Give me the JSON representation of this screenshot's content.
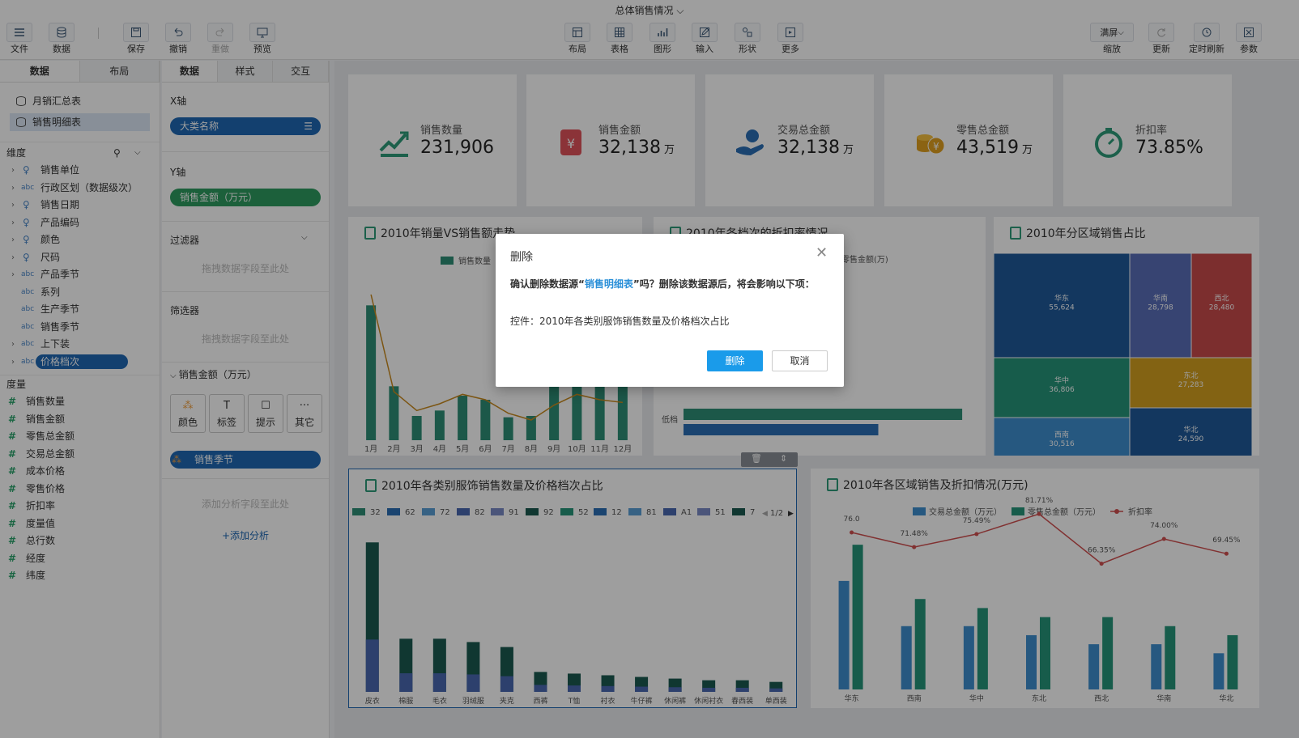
{
  "title": "总体销售情况",
  "toolbar": {
    "left": [
      {
        "label": "文件",
        "icon": "menu-icon"
      },
      {
        "label": "数据",
        "icon": "database-icon"
      },
      {
        "label": "保存",
        "icon": "save-icon"
      },
      {
        "label": "撤销",
        "icon": "undo-icon"
      },
      {
        "label": "重做",
        "icon": "redo-icon"
      },
      {
        "label": "预览",
        "icon": "preview-icon"
      }
    ],
    "center": [
      {
        "label": "布局",
        "icon": "layout-icon"
      },
      {
        "label": "表格",
        "icon": "table-icon"
      },
      {
        "label": "图形",
        "icon": "chart-icon"
      },
      {
        "label": "输入",
        "icon": "edit-icon"
      },
      {
        "label": "形状",
        "icon": "shape-icon"
      },
      {
        "label": "更多",
        "icon": "more-icon"
      }
    ],
    "right": [
      {
        "label": "缩放",
        "value": "满屏"
      },
      {
        "label": "更新",
        "icon": "refresh-icon"
      },
      {
        "label": "定时刷新",
        "icon": "clock-icon"
      },
      {
        "label": "参数",
        "icon": "param-icon"
      }
    ]
  },
  "left_panel": {
    "tabs": [
      "数据",
      "布局"
    ],
    "datasources": [
      "月销汇总表",
      "销售明细表"
    ],
    "dim_title": "维度",
    "dimensions": [
      {
        "name": "销售单位",
        "type": "geo",
        "arrow": true
      },
      {
        "name": "行政区划（数据级次）",
        "type": "abc",
        "arrow": true
      },
      {
        "name": "销售日期",
        "type": "geo",
        "arrow": true
      },
      {
        "name": "产品编码",
        "type": "geo",
        "arrow": true
      },
      {
        "name": "颜色",
        "type": "geo",
        "arrow": true
      },
      {
        "name": "尺码",
        "type": "geo",
        "arrow": true
      },
      {
        "name": "产品季节",
        "type": "abc",
        "arrow": true
      },
      {
        "name": "系列",
        "type": "abc",
        "arrow": false
      },
      {
        "name": "生产季节",
        "type": "abc",
        "arrow": false
      },
      {
        "name": "销售季节",
        "type": "abc",
        "arrow": false
      },
      {
        "name": "上下装",
        "type": "abc",
        "arrow": true
      },
      {
        "name": "价格档次",
        "type": "abc",
        "arrow": true
      }
    ],
    "meas_title": "度量",
    "measures": [
      "销售数量",
      "销售金额",
      "零售总金额",
      "交易总金额",
      "成本价格",
      "零售价格",
      "折扣率",
      "度量值",
      "总行数",
      "经度",
      "纬度"
    ]
  },
  "mid_panel": {
    "tabs": [
      "数据",
      "样式",
      "交互"
    ],
    "x_label": "X轴",
    "x_pill": "大类名称",
    "y_label": "Y轴",
    "y_pill": "销售金额（万元）",
    "filter_label": "过滤器",
    "drop_hint": "拖拽数据字段至此处",
    "screen_label": "筛选器",
    "mark_label": "销售金额（万元）",
    "marks": [
      "颜色",
      "标签",
      "提示",
      "其它"
    ],
    "color_pill": "销售季节",
    "analysis_hint": "添加分析字段至此处",
    "add_analysis": "+添加分析"
  },
  "kpis": [
    {
      "label": "销售数量",
      "value": "231,906",
      "unit": "",
      "color": "#2e9c7a"
    },
    {
      "label": "销售金额",
      "value": "32,138",
      "unit": "万",
      "color": "#e0535b"
    },
    {
      "label": "交易总金额",
      "value": "32,138",
      "unit": "万",
      "color": "#2a6fb5"
    },
    {
      "label": "零售总金额",
      "value": "43,519",
      "unit": "万",
      "color": "#e0a020"
    },
    {
      "label": "折扣率",
      "value": "73.85%",
      "unit": "",
      "color": "#2e9c7a"
    }
  ],
  "charts": {
    "c1_title": "2010年销量VS销售额走势",
    "c2_title": "2010年各档次的折扣率情况",
    "c3_title": "2010年分区域销售占比",
    "c4_title": "2010年各类别服饰销售数量及价格档次占比",
    "c5_title": "2010年各区域销售及折扣情况(万元)"
  },
  "chart_data": [
    {
      "type": "bar",
      "title": "2010年销量VS销售额走势",
      "categories": [
        "1月",
        "2月",
        "3月",
        "4月",
        "5月",
        "6月",
        "7月",
        "8月",
        "9月",
        "10月",
        "11月",
        "12月"
      ],
      "series": [
        {
          "name": "销售数量",
          "values": [
            100,
            40,
            18,
            22,
            33,
            30,
            17,
            18,
            48,
            60,
            55,
            50
          ]
        },
        {
          "name": "销售金额",
          "values": [
            108,
            36,
            22,
            27,
            34,
            30,
            20,
            15,
            26,
            34,
            30,
            28
          ]
        }
      ]
    },
    {
      "type": "bar",
      "title": "2010年各档次的折扣率情况",
      "categories": [
        "低档"
      ],
      "series": [
        {
          "name": "零售金额(万)",
          "values": [
            0.93
          ]
        },
        {
          "name": "",
          "values": [
            0.65
          ]
        }
      ]
    },
    {
      "type": "heatmap",
      "title": "2010年分区域销售占比",
      "categories": [
        "华东",
        "华南",
        "西北",
        "华中",
        "东北",
        "西南",
        "华北"
      ],
      "values": [
        55624,
        28798,
        28480,
        36806,
        27283,
        30516,
        24590
      ]
    },
    {
      "type": "bar",
      "title": "2010年各类别服饰销售数量及价格档次占比",
      "categories": [
        "皮衣",
        "棉服",
        "毛衣",
        "羽绒服",
        "夹克",
        "西裤",
        "T恤",
        "衬衣",
        "牛仔裤",
        "休闲裤",
        "休闲衬衣",
        "春西装",
        "单西装"
      ],
      "legend": [
        "32",
        "62",
        "72",
        "82",
        "91",
        "92",
        "52",
        "12",
        "81",
        "A1",
        "51",
        "7"
      ],
      "legend_page": "1/2",
      "values": [
        90,
        32,
        32,
        30,
        27,
        12,
        11,
        10,
        9,
        8,
        7,
        7,
        6
      ]
    },
    {
      "type": "bar",
      "title": "2010年各区域销售及折扣情况(万元)",
      "categories": [
        "华东",
        "西南",
        "华中",
        "东北",
        "西北",
        "华南",
        "华北"
      ],
      "series": [
        {
          "name": "交易总金额（万元）",
          "values": [
            12,
            7,
            7,
            6,
            5,
            5,
            4
          ]
        },
        {
          "name": "零售总金额（万元）",
          "values": [
            16,
            10,
            9,
            8,
            8,
            7,
            6
          ]
        },
        {
          "name": "折扣率",
          "values": [
            76.0,
            71.48,
            75.49,
            81.71,
            66.35,
            74.0,
            69.45
          ]
        }
      ],
      "labels": [
        "76.0",
        "71.48%",
        "75.49%",
        "81.71%",
        "66.35%",
        "74.00%",
        "69.45%"
      ]
    }
  ],
  "dialog": {
    "title": "删除",
    "msg_pre": "确认删除数据源“",
    "msg_name": "销售明细表",
    "msg_post": "”吗？删除该数据源后，将会影响以下项：",
    "detail": "控件：2010年各类别服饰销售数量及价格档次占比",
    "ok": "删除",
    "cancel": "取消"
  }
}
